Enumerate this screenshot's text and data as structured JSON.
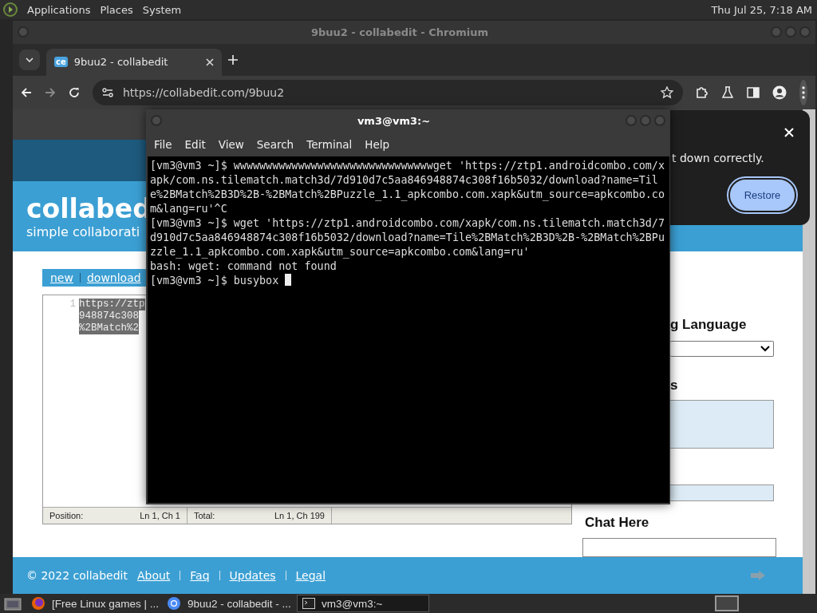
{
  "top_panel": {
    "menus": [
      "Applications",
      "Places",
      "System"
    ],
    "clock": "Thu Jul 25, 7:18 AM"
  },
  "browser": {
    "title": "9buu2 - collabedit - Chromium",
    "tabs": [
      {
        "favicon": "ce",
        "label": "9buu2 - collabedit",
        "selected": true
      }
    ],
    "url": "https://collabedit.com/9buu2",
    "page": {
      "logo": "collabed",
      "tagline": "simple collaborati",
      "nav": [
        "new",
        "download"
      ],
      "editor": {
        "line_numbers": [
          "1"
        ],
        "lines": [
          "https://ztp",
          "948874c308",
          "%2BMatch%2"
        ]
      },
      "status": [
        {
          "label": "Position:",
          "value": "Ln 1, Ch 1"
        },
        {
          "label": "Total:",
          "value": "Ln 1, Ch 199"
        }
      ],
      "sidebar": {
        "language_heading": "g Language",
        "users_heading": "s",
        "chat_heading": "Chat Here"
      },
      "footer": {
        "copyright": "© 2022 collabedit",
        "links": [
          "About",
          "Faq",
          "Updates",
          "Legal"
        ]
      }
    },
    "restore_bubble": {
      "message": "t down correctly.",
      "button": "Restore"
    }
  },
  "terminal": {
    "title": "vm3@vm3:~",
    "menus": [
      "File",
      "Edit",
      "View",
      "Search",
      "Terminal",
      "Help"
    ],
    "lines": [
      "[vm3@vm3 ~]$ wwwwwwwwwwwwwwwwwwwwwwwwwwwwwwwget 'https://ztp1.androidcombo.com/xapk/com.ns.tilematch.match3d/7d910d7c5aa846948874c308f16b5032/download?name=Tile%2BMatch%2B3D%2B-%2BMatch%2BPuzzle_1.1_apkcombo.com.xapk&utm_source=apkcombo.com&lang=ru'^C",
      "[vm3@vm3 ~]$ wget 'https://ztp1.androidcombo.com/xapk/com.ns.tilematch.match3d/7d910d7c5aa846948874c308f16b5032/download?name=Tile%2BMatch%2B3D%2B-%2BMatch%2BPuzzle_1.1_apkcombo.com.xapk&utm_source=apkcombo.com&lang=ru'",
      "bash: wget: command not found",
      "[vm3@vm3 ~]$ busybox "
    ]
  },
  "taskbar": {
    "items": [
      {
        "kind": "firefox",
        "label": "[Free Linux games | ...",
        "selected": false
      },
      {
        "kind": "chromium",
        "label": "9buu2 - collabedit - ...",
        "selected": false
      },
      {
        "kind": "terminal",
        "label": "vm3@vm3:~",
        "selected": true
      }
    ]
  }
}
